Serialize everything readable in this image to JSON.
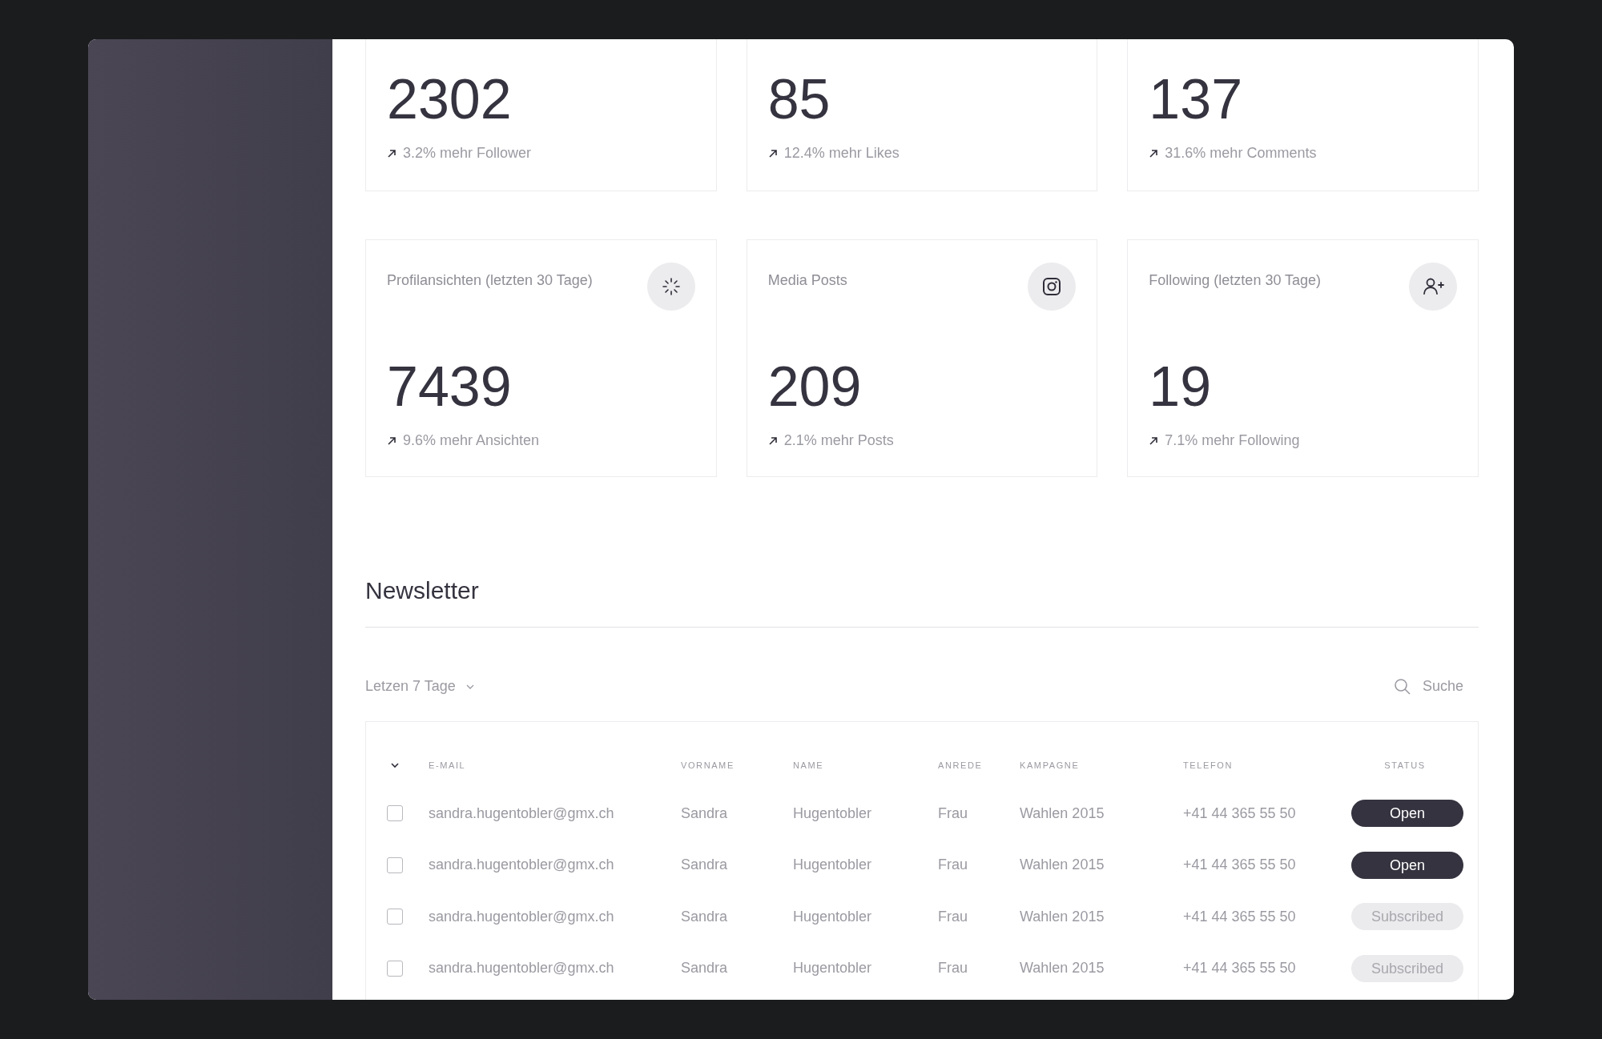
{
  "top_stats": [
    {
      "value": "2302",
      "trend": "3.2% mehr Follower"
    },
    {
      "value": "85",
      "trend": "12.4% mehr Likes"
    },
    {
      "value": "137",
      "trend": "31.6% mehr Comments"
    }
  ],
  "stats": [
    {
      "title": "Profilansichten (letzten 30 Tage)",
      "kind": "loader",
      "value": "7439",
      "trend": "9.6% mehr Ansichten"
    },
    {
      "title": "Media Posts",
      "kind": "camera",
      "value": "209",
      "trend": "2.1% mehr Posts"
    },
    {
      "title": "Following (letzten 30 Tage)",
      "kind": "user-plus",
      "value": "19",
      "trend": "7.1% mehr Following"
    }
  ],
  "newsletter": {
    "title": "Newsletter",
    "filter": "Letzen 7 Tage",
    "search": {
      "placeholder": "Suche"
    },
    "columns": [
      "E-MAIL",
      "VORNAME",
      "NAME",
      "ANREDE",
      "KAMPAGNE",
      "TELEFON",
      "STATUS"
    ],
    "rows": [
      {
        "checked": false,
        "cells": [
          "sandra.hugentobler@gmx.ch",
          "Sandra",
          "Hugentobler",
          "Frau",
          "Wahlen 2015",
          "+41 44 365 55 50"
        ],
        "status": {
          "label": "Open",
          "kind": "open"
        }
      },
      {
        "checked": false,
        "cells": [
          "sandra.hugentobler@gmx.ch",
          "Sandra",
          "Hugentobler",
          "Frau",
          "Wahlen 2015",
          "+41 44 365 55 50"
        ],
        "status": {
          "label": "Open",
          "kind": "open"
        }
      },
      {
        "checked": false,
        "cells": [
          "sandra.hugentobler@gmx.ch",
          "Sandra",
          "Hugentobler",
          "Frau",
          "Wahlen 2015",
          "+41 44 365 55 50"
        ],
        "status": {
          "label": "Subscribed",
          "kind": "subscribed"
        }
      },
      {
        "checked": false,
        "cells": [
          "sandra.hugentobler@gmx.ch",
          "Sandra",
          "Hugentobler",
          "Frau",
          "Wahlen 2015",
          "+41 44 365 55 50"
        ],
        "status": {
          "label": "Subscribed",
          "kind": "subscribed"
        }
      }
    ]
  }
}
